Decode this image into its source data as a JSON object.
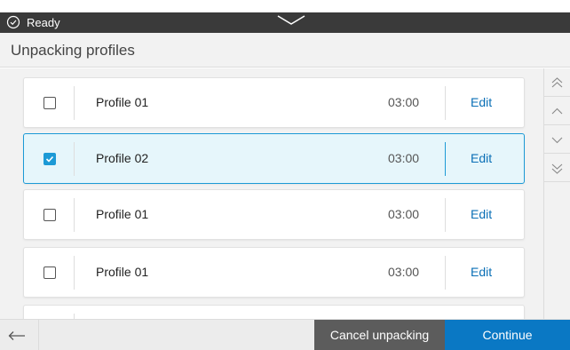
{
  "status": {
    "text": "Ready",
    "icon": "check-circle-icon"
  },
  "header": {
    "title": "Unpacking profiles"
  },
  "profiles": [
    {
      "name": "Profile 01",
      "time": "03:00",
      "edit_label": "Edit",
      "checked": false
    },
    {
      "name": "Profile 02",
      "time": "03:00",
      "edit_label": "Edit",
      "checked": true
    },
    {
      "name": "Profile 01",
      "time": "03:00",
      "edit_label": "Edit",
      "checked": false
    },
    {
      "name": "Profile 01",
      "time": "03:00",
      "edit_label": "Edit",
      "checked": false
    }
  ],
  "scroll": [
    "scroll-top-icon",
    "scroll-up-icon",
    "scroll-down-icon",
    "scroll-bottom-icon"
  ],
  "footer": {
    "cancel_label": "Cancel unpacking",
    "continue_label": "Continue"
  },
  "colors": {
    "accent": "#1c9ad6",
    "primary_button": "#0a78c4",
    "secondary_button": "#5c5c5c",
    "status_bar": "#3a3a3a"
  }
}
